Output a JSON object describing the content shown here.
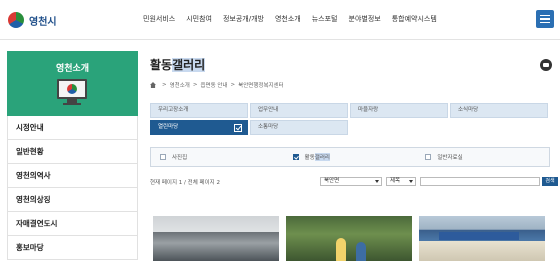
{
  "header": {
    "logo_text": "영천시",
    "nav": [
      "민원서비스",
      "시민참여",
      "정보공개/개방",
      "영천소개",
      "뉴스포털",
      "분야별정보",
      "통합예약시스템"
    ]
  },
  "sidebar": {
    "title": "영천소개",
    "items": [
      "시정안내",
      "일반현황",
      "영천의역사",
      "영천의상징",
      "자매결연도시",
      "홍보마당"
    ]
  },
  "page": {
    "title_prefix": "활동",
    "title_highlight": "갤러리",
    "breadcrumb": [
      "영천소개",
      "읍면동 안내",
      "북안면행정복지센터"
    ]
  },
  "tabs": {
    "row1": [
      "우리고장소개",
      "업무안내",
      "마을자랑",
      "소식마당"
    ],
    "row2": [
      "열린마당",
      "소통마당"
    ],
    "active": "열린마당"
  },
  "filters": [
    {
      "label": "사진집",
      "checked": false
    },
    {
      "label_prefix": "활동",
      "label_highlight": "갤러리",
      "checked": true
    },
    {
      "label": "일반자료실",
      "checked": false
    }
  ],
  "list": {
    "page_info": "현재 페이지 1 / 전체 페이지 2",
    "dept_select": "북안면",
    "field_select": "제목",
    "search_button": "검색"
  },
  "colors": {
    "sidebar_green": "#2aa37a",
    "active_tab": "#1f5a91",
    "menu_blue": "#2b6fb3"
  }
}
